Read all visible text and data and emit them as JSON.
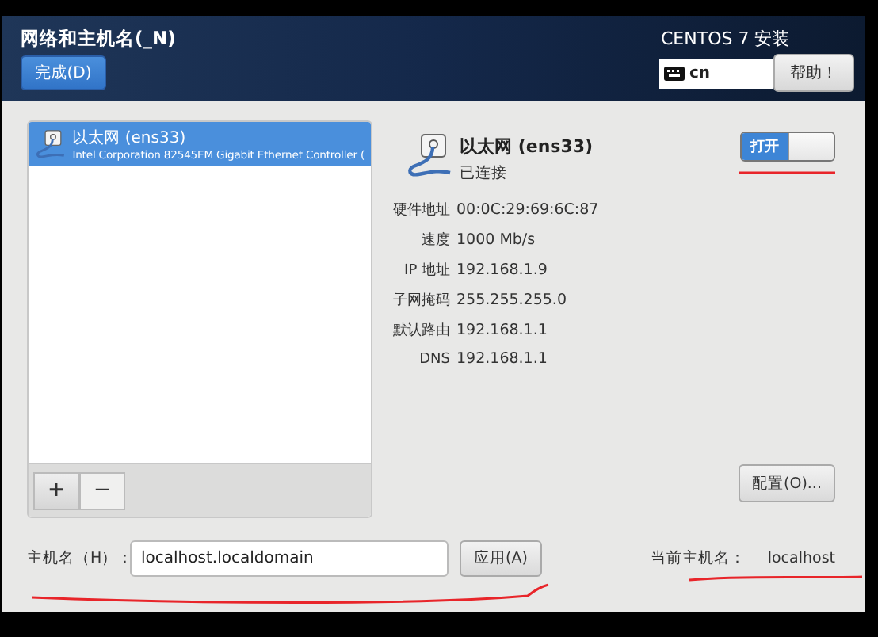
{
  "header": {
    "title": "网络和主机名(_N)",
    "done_button": "完成(D)",
    "product": "CENTOS 7 安装",
    "keyboard_layout": "cn",
    "help_button": "帮助！"
  },
  "connections": [
    {
      "name": "以太网 (ens33)",
      "description": "Intel Corporation 82545EM Gigabit Ethernet Controller (",
      "selected": true
    }
  ],
  "list_buttons": [
    "+",
    "−"
  ],
  "detail": {
    "name": "以太网 (ens33)",
    "status": "已连接",
    "switch": {
      "label": "打开",
      "on": true
    },
    "properties": [
      {
        "label": "硬件地址",
        "value": "00:0C:29:69:6C:87"
      },
      {
        "label": "速度",
        "value": "1000 Mb/s"
      },
      {
        "label": "IP 地址",
        "value": "192.168.1.9"
      },
      {
        "label": "子网掩码",
        "value": "255.255.255.0"
      },
      {
        "label": "默认路由",
        "value": "192.168.1.1"
      },
      {
        "label": "DNS",
        "value": "192.168.1.1"
      }
    ],
    "configure_button": "配置(O)..."
  },
  "hostname": {
    "label": "主机名（H）：",
    "value": "localhost.localdomain",
    "apply_button": "应用(A)",
    "current_label": "当前主机名：",
    "current_value": "localhost"
  }
}
